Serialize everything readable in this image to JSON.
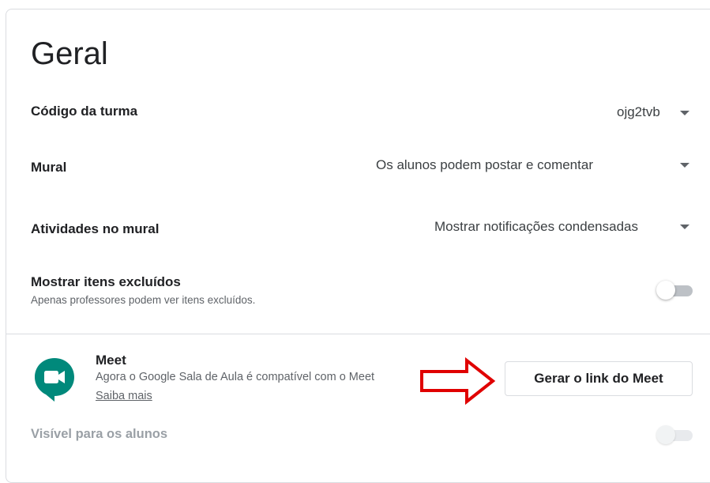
{
  "header": {
    "title": "Geral"
  },
  "settings": {
    "class_code": {
      "label": "Código da turma",
      "value": "ojg2tvb"
    },
    "stream": {
      "label": "Mural",
      "value": "Os alunos podem postar e comentar"
    },
    "classwork_on_stream": {
      "label": "Atividades no mural",
      "value": "Mostrar notificações condensadas"
    },
    "show_deleted": {
      "label": "Mostrar itens excluídos",
      "description": "Apenas professores podem ver itens excluídos.",
      "enabled": false
    }
  },
  "meet": {
    "title": "Meet",
    "description": "Agora o Google Sala de Aula é compatível com o Meet",
    "learn_more": "Saiba mais",
    "generate_button": "Gerar o link do Meet",
    "visible_label": "Visível para os alunos",
    "visible_enabled": false,
    "icon": "google-meet-icon"
  },
  "colors": {
    "annotation_arrow": "#e00000",
    "meet_icon": "#00897b"
  }
}
